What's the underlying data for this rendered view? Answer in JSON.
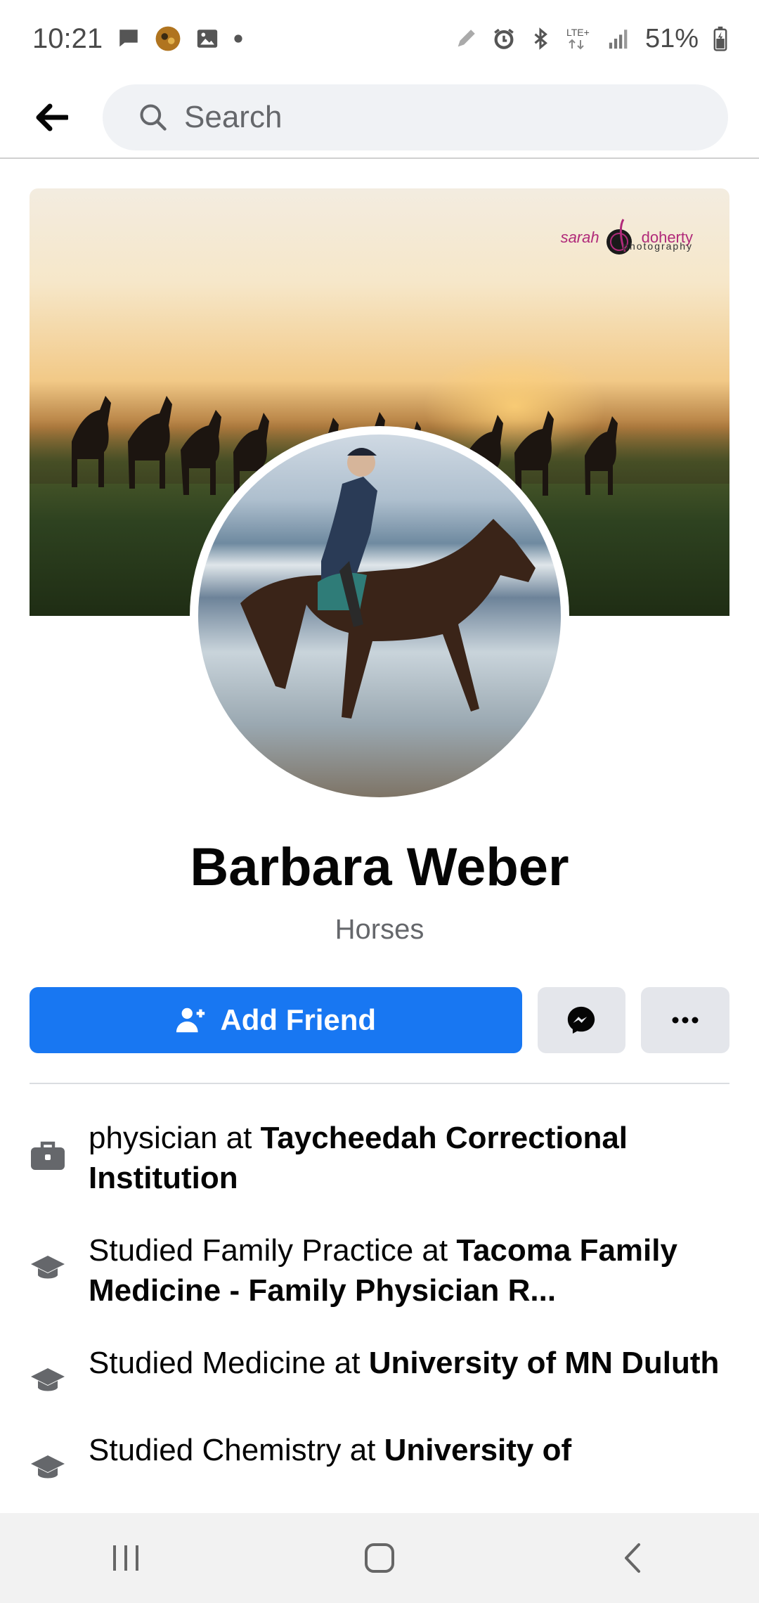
{
  "status_bar": {
    "time": "10:21",
    "battery": "51%",
    "network": "LTE+"
  },
  "header": {
    "search_placeholder": "Search"
  },
  "cover": {
    "watermark_name_1": "sarah",
    "watermark_name_2": "doherty",
    "watermark_sub": "photography"
  },
  "profile": {
    "name": "Barbara Weber",
    "subtitle": "Horses"
  },
  "actions": {
    "add_friend_label": "Add Friend"
  },
  "intro": [
    {
      "icon": "briefcase-icon",
      "prefix": "physician at ",
      "bold": "Taycheedah Correctional Institution"
    },
    {
      "icon": "graduation-cap-icon",
      "prefix": "Studied Family Practice at ",
      "bold": "Tacoma Family Medicine - Family Physician R..."
    },
    {
      "icon": "graduation-cap-icon",
      "prefix": "Studied Medicine at ",
      "bold": "University of MN Duluth"
    },
    {
      "icon": "graduation-cap-icon",
      "prefix": "Studied Chemistry at ",
      "bold": "University of"
    }
  ],
  "colors": {
    "primary": "#1877f2",
    "button_gray": "#e4e6eb",
    "text_secondary": "#65676b",
    "watermark": "#b02a7a"
  }
}
